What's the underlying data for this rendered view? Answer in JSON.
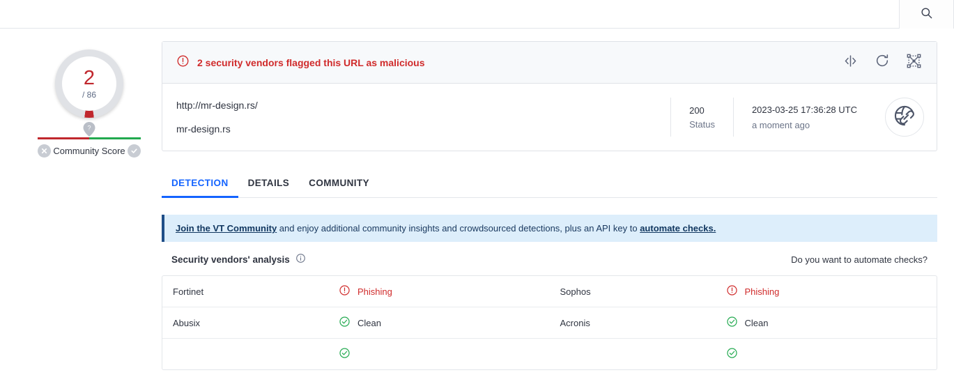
{
  "topbar": {
    "search_icon": "search-icon"
  },
  "score": {
    "detections": "2",
    "total": "/ 86",
    "community_label": "Community Score",
    "community_marker": "?",
    "negative_icon": "x-circle-icon",
    "positive_icon": "check-circle-icon"
  },
  "alert": {
    "icon": "exclamation-circle-icon",
    "message": "2 security vendors flagged this URL as malicious",
    "actions": [
      {
        "name": "compare-icon"
      },
      {
        "name": "reanalyze-icon"
      },
      {
        "name": "graph-icon"
      }
    ]
  },
  "target": {
    "url": "http://mr-design.rs/",
    "domain": "mr-design.rs",
    "status_value": "200",
    "status_label": "Status",
    "scan_date": "2023-03-25 17:36:28 UTC",
    "scan_relative": "a moment ago",
    "avatar_icon": "globe-link-icon"
  },
  "tabs": [
    {
      "label": "DETECTION",
      "active": true
    },
    {
      "label": "DETAILS",
      "active": false
    },
    {
      "label": "COMMUNITY",
      "active": false
    }
  ],
  "banner": {
    "link1": "Join the VT Community",
    "middle": " and enjoy additional community insights and crowdsourced detections, plus an API key to ",
    "link2": "automate checks."
  },
  "vendors_section": {
    "title": "Security vendors' analysis",
    "info_icon": "info-icon",
    "automate_text": "Do you want to automate checks?"
  },
  "vendors": [
    {
      "left": {
        "name": "Fortinet",
        "verdict": "Phishing",
        "state": "malicious"
      },
      "right": {
        "name": "Sophos",
        "verdict": "Phishing",
        "state": "malicious"
      }
    },
    {
      "left": {
        "name": "Abusix",
        "verdict": "Clean",
        "state": "clean"
      },
      "right": {
        "name": "Acronis",
        "verdict": "Clean",
        "state": "clean"
      }
    },
    {
      "left": {
        "name": "",
        "verdict": "",
        "state": "clean"
      },
      "right": {
        "name": "",
        "verdict": "",
        "state": "clean"
      }
    }
  ],
  "colors": {
    "malicious": "#d02b2b",
    "clean": "#22a94f",
    "accent": "#1464ff",
    "banner_bg": "#ddeefb"
  }
}
